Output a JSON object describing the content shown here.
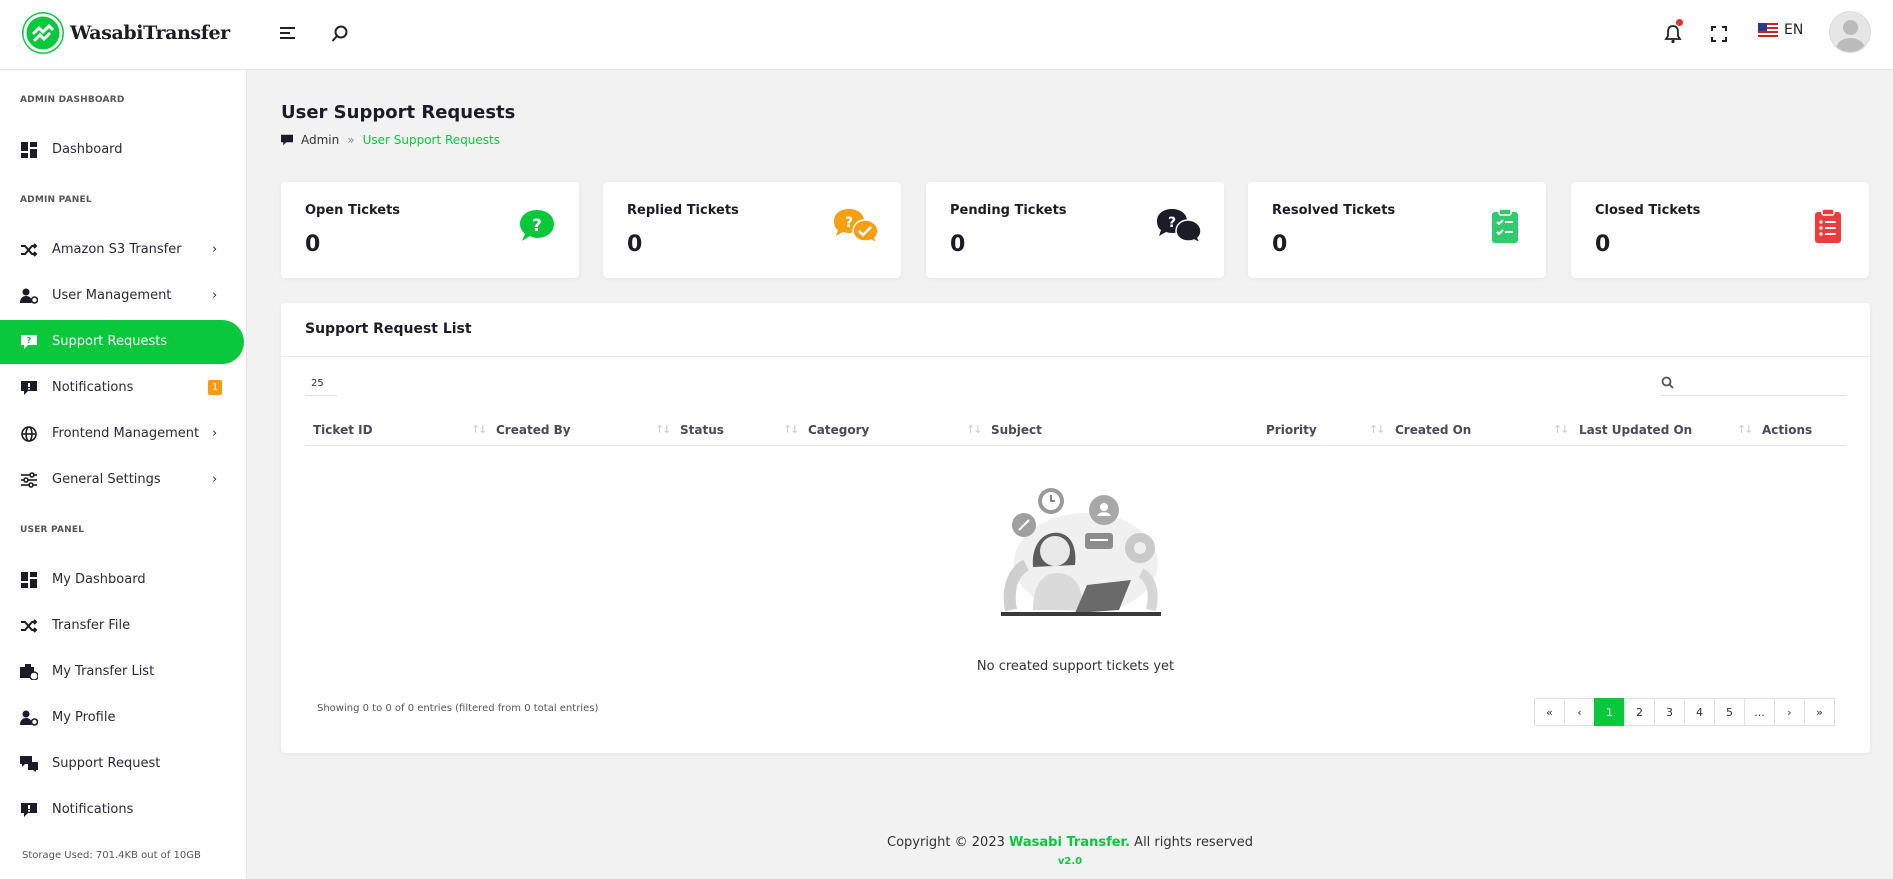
{
  "brand": {
    "name": "WasabiTransfer",
    "accent": "#09c83c"
  },
  "header": {
    "language": "EN",
    "icons": [
      "menu-icon",
      "search-icon",
      "bell-icon",
      "fullscreen-icon",
      "flag-icon",
      "avatar"
    ]
  },
  "sidebar": {
    "sections": {
      "admin_dashboard": "ADMIN DASHBOARD",
      "admin_panel": "ADMIN PANEL",
      "user_panel": "USER PANEL"
    },
    "items": [
      {
        "label": "Dashboard"
      },
      {
        "label": "Amazon S3 Transfer"
      },
      {
        "label": "User Management"
      },
      {
        "label": "Support Requests"
      },
      {
        "label": "Notifications",
        "badge": "1"
      },
      {
        "label": "Frontend Management"
      },
      {
        "label": "General Settings"
      },
      {
        "label": "My Dashboard"
      },
      {
        "label": "Transfer File"
      },
      {
        "label": "My Transfer List"
      },
      {
        "label": "My Profile"
      },
      {
        "label": "Support Request"
      },
      {
        "label": "Notifications"
      }
    ],
    "storage": "Storage Used: 701.4KB out of 10GB"
  },
  "page": {
    "title": "User Support Requests",
    "breadcrumb": {
      "root": "Admin",
      "separator": "»",
      "current": "User Support Requests"
    }
  },
  "stats": [
    {
      "label": "Open Tickets",
      "value": "0",
      "color": "#09c83c"
    },
    {
      "label": "Replied Tickets",
      "value": "0",
      "color": "#f5a014"
    },
    {
      "label": "Pending Tickets",
      "value": "0",
      "color": "#1c1c28"
    },
    {
      "label": "Resolved Tickets",
      "value": "0",
      "color": "#2fcb6c"
    },
    {
      "label": "Closed Tickets",
      "value": "0",
      "color": "#ee3b3b"
    }
  ],
  "list": {
    "title": "Support Request List",
    "page_length": "25",
    "columns": [
      "Ticket ID",
      "Created By",
      "Status",
      "Category",
      "Subject",
      "Priority",
      "Created On",
      "Last Updated On",
      "Actions"
    ],
    "empty_text": "No created support tickets yet",
    "info": "Showing 0 to 0 of 0 entries (filtered from 0 total entries)",
    "pagination": [
      "«",
      "‹",
      "1",
      "2",
      "3",
      "4",
      "5",
      "...",
      "›",
      "»"
    ],
    "current_page": "1"
  },
  "footer": {
    "prefix": "Copyright © 2023 ",
    "brand": "Wasabi Transfer.",
    "suffix": " All rights reserved",
    "version": "v2.0"
  }
}
